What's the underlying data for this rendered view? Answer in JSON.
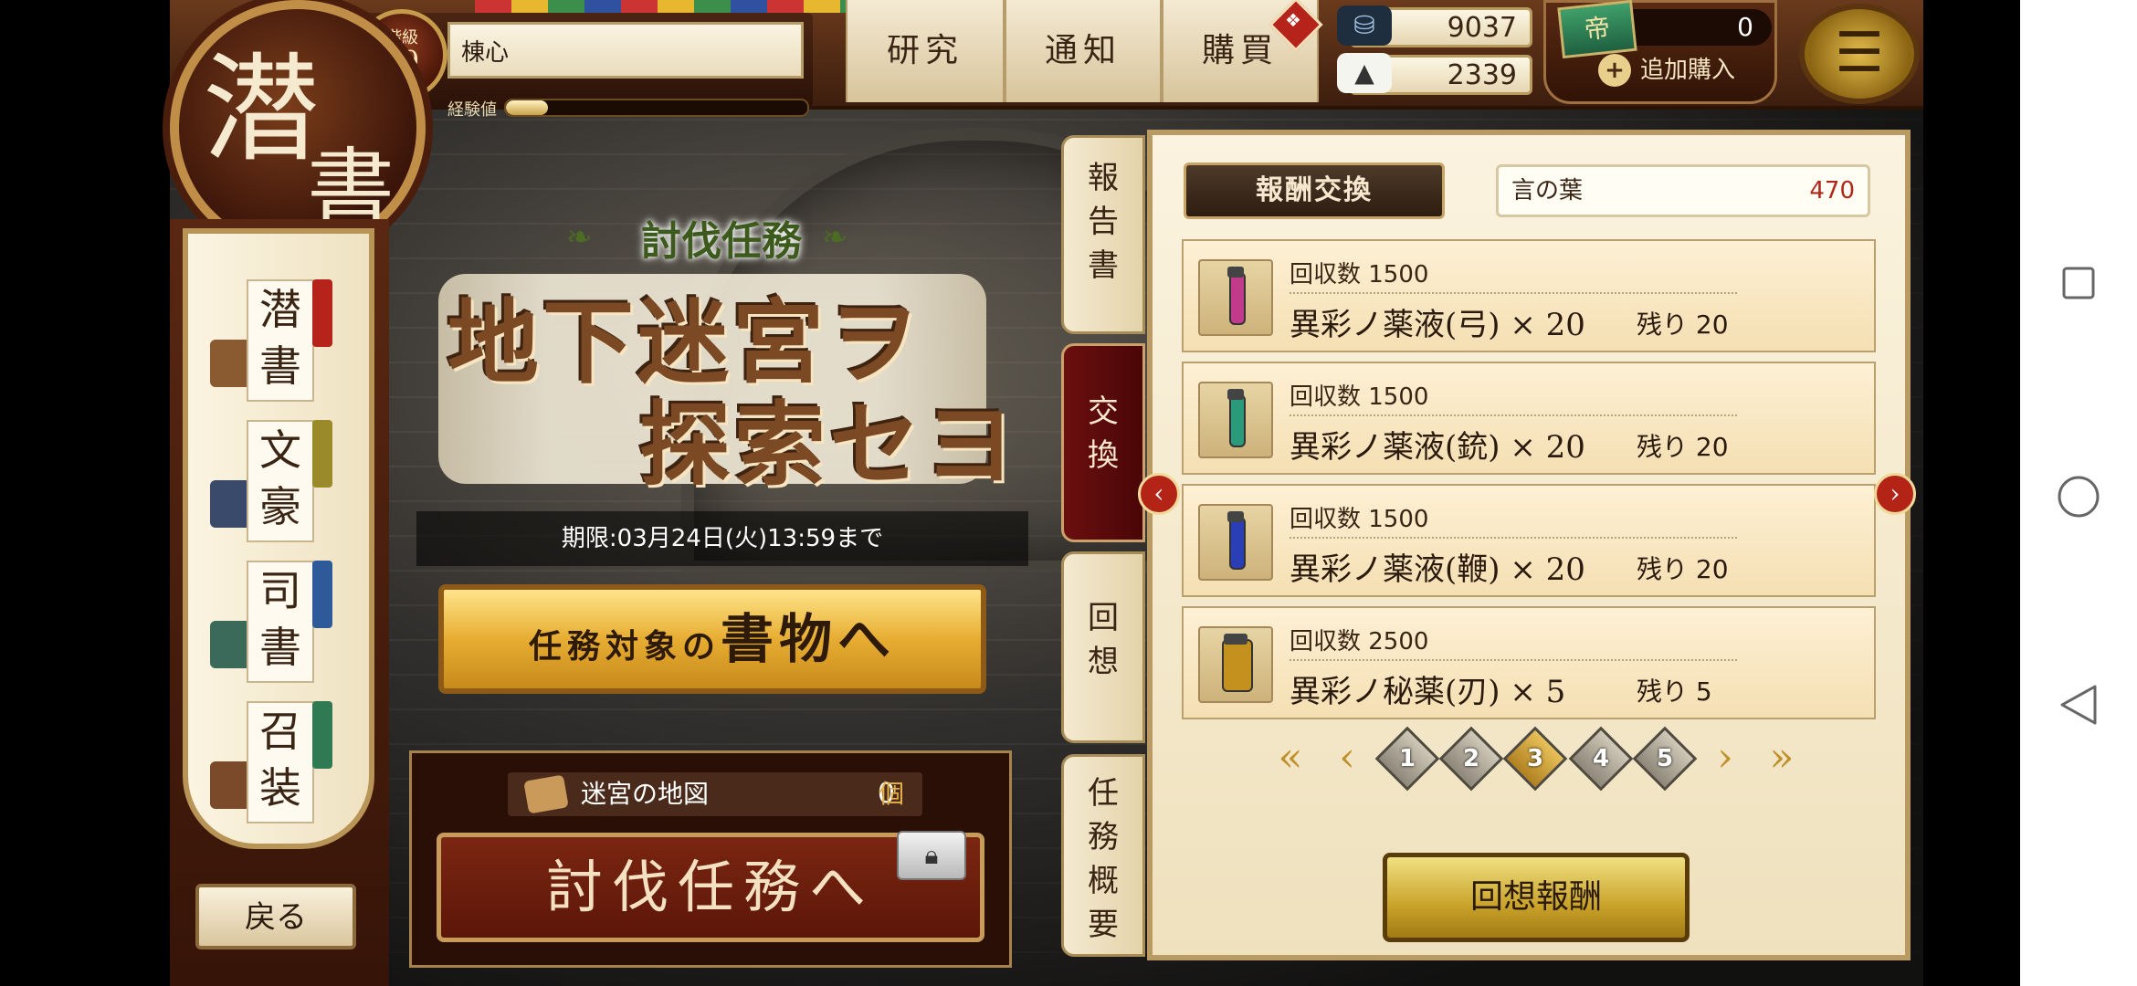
{
  "header": {
    "logo_char1": "潜",
    "logo_char2": "書",
    "rank_label": "階級",
    "rank_value": "19",
    "player_name": "棟心",
    "exp_label": "経験値",
    "exp_progress": 0.14,
    "tabs": [
      {
        "label": "研究"
      },
      {
        "label": "通知"
      },
      {
        "label": "購買"
      }
    ],
    "resources": {
      "ink": "9037",
      "food": "2339",
      "ticket": "0",
      "ticket_icon": "帝",
      "add_buy": "追加購入"
    },
    "menu_icon": "menu-icon"
  },
  "sidebar": {
    "items": [
      {
        "c1": "潜",
        "c2": "書",
        "tag_color": "#b5231a"
      },
      {
        "c1": "文",
        "c2": "豪",
        "tag_color": "#9a8a2a"
      },
      {
        "c1": "司",
        "c2": "書",
        "tag_color": "#2e5a9a"
      },
      {
        "c1": "召",
        "c2": "装",
        "tag_color": "#2f7a52"
      }
    ],
    "back_label": "戻る"
  },
  "event": {
    "subtitle": "討伐任務",
    "title_line1": "地下迷宮ヲ",
    "title_line2": "探索セヨ",
    "deadline": "期限:03月24日(火)13:59まで",
    "target_button_small": "任務対象の",
    "target_button_big": "書物へ",
    "map_label": "迷宮の地図",
    "map_count": "0",
    "map_unit": "個",
    "subjugation_button": "討伐任務へ"
  },
  "vertical_tabs": [
    {
      "label": [
        "報",
        "告",
        "書"
      ],
      "active": false
    },
    {
      "label": [
        "交",
        "換"
      ],
      "active": true
    },
    {
      "label": [
        "回",
        "想"
      ],
      "active": false
    },
    {
      "label": [
        "任",
        "務",
        "概",
        "要"
      ],
      "active": false
    }
  ],
  "reward_panel": {
    "header": "報酬交換",
    "currency_label": "言の葉",
    "currency_value": "470",
    "rows": [
      {
        "cost": "回収数 1500",
        "name": "異彩ノ薬液(弓) × 20",
        "remain": "残り  20",
        "color": "#c23a8a"
      },
      {
        "cost": "回収数 1500",
        "name": "異彩ノ薬液(銃) × 20",
        "remain": "残り  20",
        "color": "#2a9a7a"
      },
      {
        "cost": "回収数 1500",
        "name": "異彩ノ薬液(鞭) × 20",
        "remain": "残り  20",
        "color": "#2a3eb5"
      },
      {
        "cost": "回収数 2500",
        "name": "異彩ノ秘薬(刃) × 5",
        "remain": "残り  5",
        "color": "#c4901e"
      }
    ],
    "pages": [
      "1",
      "2",
      "3",
      "4",
      "5"
    ],
    "active_page": 3,
    "recall_button": "回想報酬"
  }
}
